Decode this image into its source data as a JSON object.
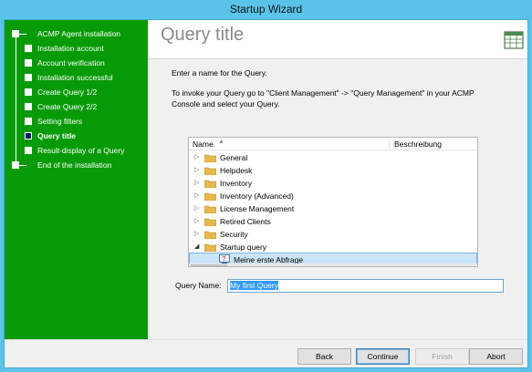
{
  "window": {
    "title": "Startup Wizard"
  },
  "steps": [
    {
      "label": "ACMP Agent installation",
      "active": false
    },
    {
      "label": "Installation account",
      "active": false
    },
    {
      "label": "Account verification",
      "active": false
    },
    {
      "label": "Installation successful",
      "active": false
    },
    {
      "label": "Create Query 1/2",
      "active": false
    },
    {
      "label": "Create Query 2/2",
      "active": false
    },
    {
      "label": "Setting filters",
      "active": false
    },
    {
      "label": "Query title",
      "active": true
    },
    {
      "label": "Result-display of a Query",
      "active": false
    },
    {
      "label": "End of the installation",
      "active": false
    }
  ],
  "page": {
    "title": "Query title",
    "instruction": "Enter a name for the Query.",
    "hint_line1": "To invoke your Query go to \"Client Management\" -> \"Query Management\" in your ACMP",
    "hint_line2": "Console and select your Query."
  },
  "tree": {
    "columns": [
      "Name",
      "Beschreibung"
    ],
    "folders": [
      {
        "label": "General",
        "expanded": false
      },
      {
        "label": "Helpdesk",
        "expanded": false
      },
      {
        "label": "Inventory",
        "expanded": false
      },
      {
        "label": "Inventory (Advanced)",
        "expanded": false
      },
      {
        "label": "License Management",
        "expanded": false
      },
      {
        "label": "Retired Clients",
        "expanded": false
      },
      {
        "label": "Security",
        "expanded": false
      },
      {
        "label": "Startup query",
        "expanded": true
      }
    ],
    "selected_item": "Meine erste Abfrage"
  },
  "query_name": {
    "label": "Query Name:",
    "value": "My first Query"
  },
  "buttons": {
    "back": "Back",
    "continue": "Continue",
    "finish": "Finish",
    "abort": "Abort"
  },
  "colors": {
    "sidebar": "#079b07",
    "titlebar": "#5ac3ea",
    "selection": "#cce4f7"
  }
}
